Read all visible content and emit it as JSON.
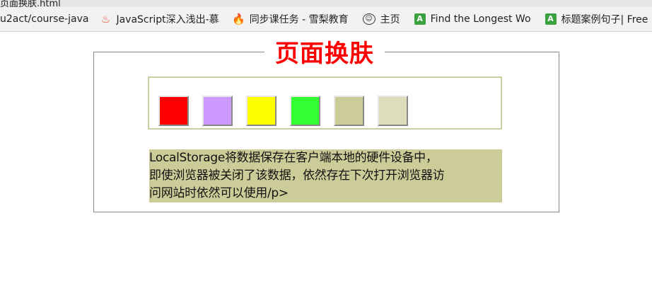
{
  "browser": {
    "tab_title": "页面换肤.html",
    "bookmarks": [
      {
        "label": "u2act/course-java",
        "icon": "none"
      },
      {
        "label": "JavaScript深入浅出-慕",
        "icon": "flame-icon"
      },
      {
        "label": "同步课任务 - 雪梨教育",
        "icon": "fire-icon"
      },
      {
        "label": "主页",
        "icon": "github-icon"
      },
      {
        "label": "Find the Longest Wo",
        "icon": "green-book-icon"
      },
      {
        "label": "标题案例句子| Free",
        "icon": "green-book-icon"
      }
    ]
  },
  "page": {
    "title": "页面换肤",
    "swatches": [
      {
        "color": "#ff0000",
        "name": "red"
      },
      {
        "color": "#cc99ff",
        "name": "purple"
      },
      {
        "color": "#ffff00",
        "name": "yellow"
      },
      {
        "color": "#33ff33",
        "name": "green"
      },
      {
        "color": "#cccc99",
        "name": "olive"
      },
      {
        "color": "#ddddbb",
        "name": "beige"
      }
    ],
    "description_lines": [
      "LocalStorage将数据保存在客户端本地的硬件设备中，",
      "即使浏览器被关闭了该数据，依然存在下次打开浏览器访",
      "问网站时依然可以使用/p>"
    ],
    "description_background": "#cccc99",
    "title_color": "#ff0000"
  }
}
